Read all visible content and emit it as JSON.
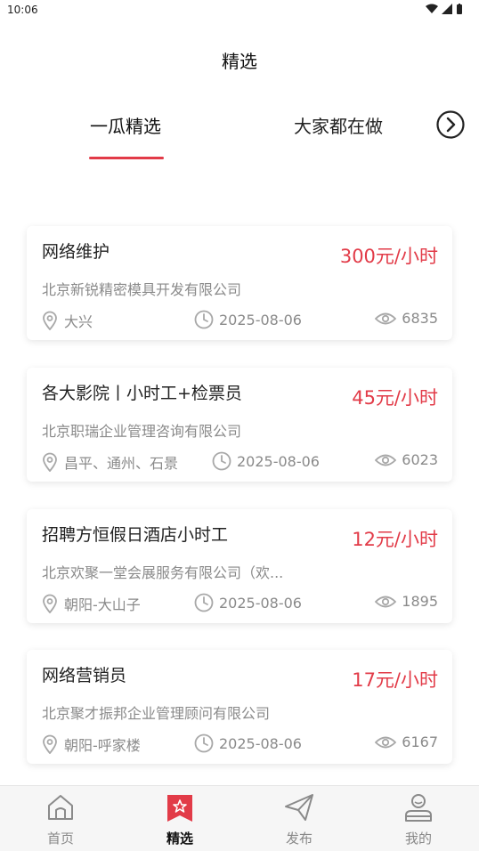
{
  "status": {
    "time": "10:06"
  },
  "header": {
    "title": "精选"
  },
  "tabs": [
    {
      "label": "一瓜精选",
      "active": true
    },
    {
      "label": "大家都在做",
      "active": false
    }
  ],
  "colors": {
    "accent": "#e23b48",
    "muted": "#8a8a8a"
  },
  "jobs": [
    {
      "title": "网络维护",
      "price": "300元/小时",
      "company": "北京新锐精密模具开发有限公司",
      "location": "大兴",
      "date": "2025-08-06",
      "views": "6835"
    },
    {
      "title": "各大影院丨小时工+检票员",
      "price": "45元/小时",
      "company": "北京职瑞企业管理咨询有限公司",
      "location": "昌平、通州、石景",
      "date": "2025-08-06",
      "views": "6023"
    },
    {
      "title": "招聘方恒假日酒店小时工",
      "price": "12元/小时",
      "company": "北京欢聚一堂会展服务有限公司（欢...",
      "location": "朝阳-大山子",
      "date": "2025-08-06",
      "views": "1895"
    },
    {
      "title": "网络营销员",
      "price": "17元/小时",
      "company": "北京聚才振邦企业管理顾问有限公司",
      "location": "朝阳-呼家楼",
      "date": "2025-08-06",
      "views": "6167"
    }
  ],
  "nav": {
    "home": "首页",
    "pick": "精选",
    "post": "发布",
    "mine": "我的"
  },
  "icons": [
    "location-icon",
    "clock-icon",
    "eye-icon",
    "chevron-right-icon",
    "home-icon",
    "star-icon",
    "send-icon",
    "user-icon"
  ]
}
